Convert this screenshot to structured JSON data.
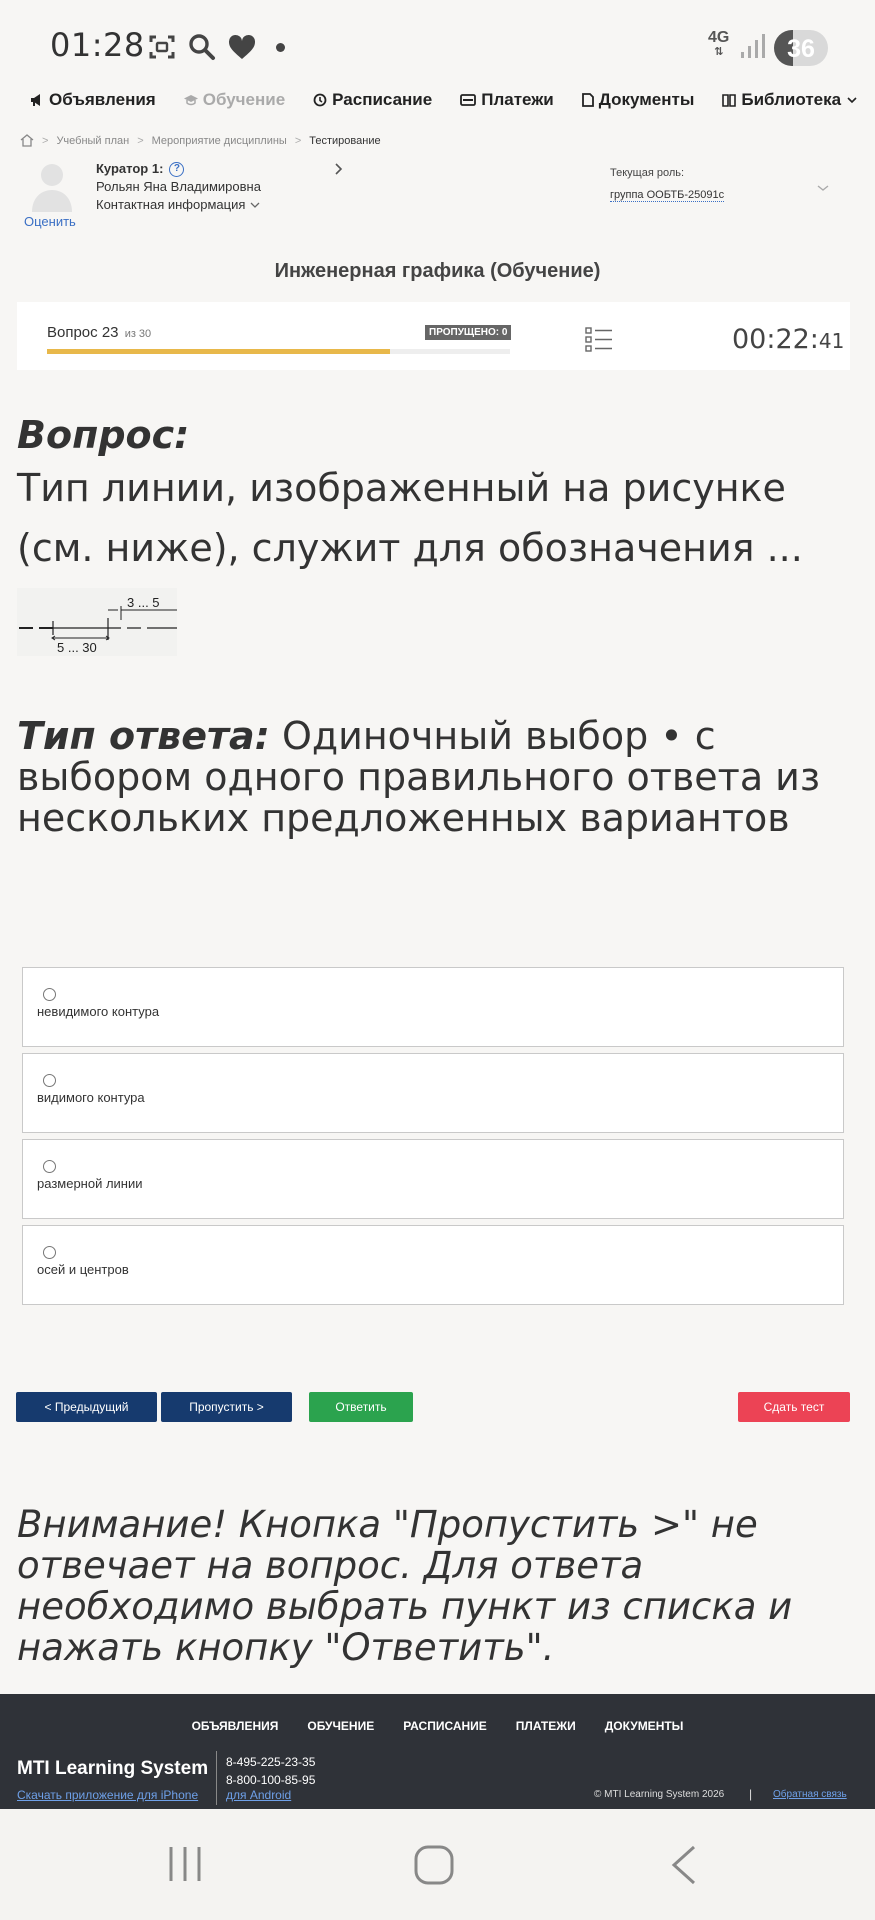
{
  "status_bar": {
    "time": "01:28",
    "network": "4G",
    "battery": "36",
    "battery_level": 0.36,
    "icons": [
      "screenshot-icon",
      "search-icon",
      "heart-icon",
      "dot-icon",
      "signal-icon"
    ]
  },
  "nav": {
    "items": [
      {
        "label": "Объявления",
        "icon": "megaphone-icon"
      },
      {
        "label": "Обучение",
        "icon": "graduation-cap-icon"
      },
      {
        "label": "Расписание",
        "icon": "clock-icon"
      },
      {
        "label": "Платежи",
        "icon": "card-icon"
      },
      {
        "label": "Документы",
        "icon": "document-icon"
      },
      {
        "label": "Библиотека",
        "icon": "book-icon"
      }
    ]
  },
  "breadcrumb": {
    "home_icon": "home-icon",
    "items": [
      "Учебный план",
      "Мероприятие дисциплины",
      "Тестирование"
    ]
  },
  "curator": {
    "title": "Куратор 1:",
    "name": "Рольян Яна Владимировна",
    "contact": "Контактная информация",
    "rate": "Оценить"
  },
  "role": {
    "label": "Текущая роль:",
    "value": "группа ООБТБ-25091с"
  },
  "course": {
    "title": "Инженерная графика (Обучение)"
  },
  "progress": {
    "question_label": "Вопрос 23",
    "of_label": "из 30",
    "skipped_label": "ПРОПУЩЕНО: 0",
    "fraction": 0.74,
    "timer_main": "00:22:",
    "timer_sec": "41"
  },
  "question": {
    "heading": "Вопрос:",
    "text": "Тип линии, изображенный на рисунке (см. ниже), служит для обозначения ...",
    "figure_labels": {
      "top": "3 ... 5",
      "bottom": "5 ... 30"
    }
  },
  "answer_type": {
    "label": "Тип ответа:",
    "text": "Одиночный выбор • с выбором одного правильного ответа из нескольких предложенных вариантов"
  },
  "options": [
    "невидимого контура",
    "видимого контура",
    "размерной линии",
    "осей и центров"
  ],
  "buttons": {
    "prev": "< Предыдущий",
    "skip": "Пропустить >",
    "answer": "Ответить",
    "submit": "Сдать тест"
  },
  "warning": "Внимание! Кнопка \"Пропустить >\" не отвечает на вопрос. Для ответа необходимо выбрать пункт из списка и нажать кнопку \"Ответить\".",
  "footer": {
    "nav": [
      "ОБЪЯВЛЕНИЯ",
      "ОБУЧЕНИЕ",
      "РАСПИСАНИЕ",
      "ПЛАТЕЖИ",
      "ДОКУМЕНТЫ"
    ],
    "brand": "MTI Learning System",
    "iphone_link": "Скачать приложение для iPhone",
    "phone1": "8-495-225-23-35",
    "phone2": "8-800-100-85-95",
    "android_link": "для Android",
    "copyright": "© MTI Learning System 2026",
    "separator": "|",
    "feedback": "Обратная связь"
  },
  "colors": {
    "primary_dark": "#163a6e",
    "answer_green": "#2ba34e",
    "submit_red": "#ec4355",
    "progress_yellow": "#e8b84a",
    "footer_bg": "#2f3238",
    "link_blue": "#3a6fc4"
  }
}
